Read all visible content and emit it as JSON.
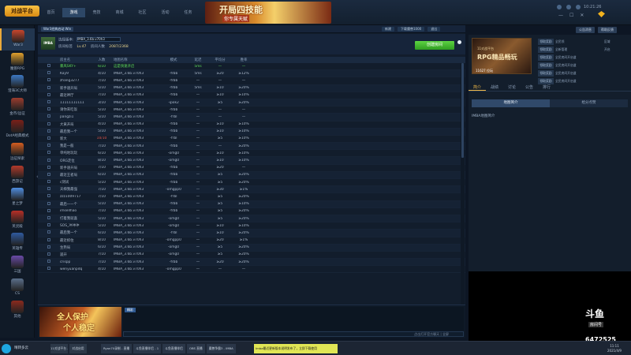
{
  "topbar": {
    "logo": "对战平台",
    "nav": [
      "首页",
      "游戏",
      "竞技",
      "商城",
      "社区",
      "活动",
      "任务",
      "客服"
    ],
    "active_nav_index": 1,
    "banner_title": "开局四技能",
    "banner_subtitle": "你专属天赋",
    "time": "10:21:26",
    "window_controls": [
      "—",
      "☐",
      "✕"
    ]
  },
  "sidebar": {
    "items": [
      {
        "label": "War3",
        "color": "#c8452c"
      },
      {
        "label": "魔兽RPG",
        "color": "#e2a12c"
      },
      {
        "label": "澄海3C大师",
        "color": "#3c78c2"
      },
      {
        "label": "金币/远征",
        "color": "#9b3c2e"
      },
      {
        "label": "DotA经典模式",
        "color": "#7a1f18"
      },
      {
        "label": "远征探索",
        "color": "#d45d1f"
      },
      {
        "label": "西游记",
        "color": "#b33a2b"
      },
      {
        "label": "星之梦",
        "color": "#4f8de0"
      },
      {
        "label": "英灵殿",
        "color": "#b82f27"
      },
      {
        "label": "英雄传",
        "color": "#2f5a9f"
      },
      {
        "label": "三国",
        "color": "#6a4aa8"
      },
      {
        "label": "CS",
        "color": "#5a6f8a"
      },
      {
        "label": "其他",
        "color": "#8b2a1e"
      }
    ],
    "selected_index": 0
  },
  "room": {
    "tag": "War3经典启动 Win",
    "right_buttons": [
      "新建",
      "下载魔兽1000",
      "退出"
    ],
    "map_thumb": "IMBA",
    "version_label": "选择版本:",
    "version_value": "IMBA_3.6b.v70h3",
    "info_label": "房间标签",
    "info_items": [
      "Lv.47",
      "房间人数",
      "2087/2368"
    ],
    "create_button": "创建房间"
  },
  "table": {
    "headers": [
      "",
      "房主名",
      "人数",
      "地图名称",
      "模式",
      "延迟",
      "平均分",
      "胜率"
    ],
    "rows": [
      {
        "name": "暴风SKY+",
        "players": "6/10",
        "map": "这是快速开启",
        "mode": "",
        "ping": "5ms",
        "score": "—",
        "rate": "—",
        "highlight": true,
        "full": false
      },
      {
        "name": "Kay9",
        "players": "4/10",
        "map": "IMBA_3.6b.v70h3",
        "mode": "-frbb",
        "ping": "5ms",
        "score": "≥20",
        "rate": "≥12%",
        "highlight": false,
        "full": false
      },
      {
        "name": "zhang3277",
        "players": "7/10",
        "map": "IMBA_3.6b.v70h3",
        "mode": "-frbb",
        "ping": "—",
        "score": "—",
        "rate": "—",
        "highlight": false,
        "full": false
      },
      {
        "name": "新手速开局",
        "players": "5/10",
        "map": "IMBA_3.6b.v70h3",
        "mode": "-frbb",
        "ping": "5ms",
        "score": "≥10",
        "rate": "≥20%",
        "highlight": false,
        "full": false
      },
      {
        "name": "最近神厅",
        "players": "7/10",
        "map": "IMBA_3.6b.v70h3",
        "mode": "-frbb",
        "ping": "—",
        "score": "≥10",
        "rate": "≥10%",
        "highlight": false,
        "full": false
      },
      {
        "name": "11111111111",
        "players": "3/10",
        "map": "IMBA_3.6b.v70h3",
        "mode": "-ipok2",
        "ping": "—",
        "score": "≥5",
        "rate": "≥20%",
        "highlight": false,
        "full": false
      },
      {
        "name": "请你来吃饭",
        "players": "5/10",
        "map": "IMBA_3.6b.v70h3",
        "mode": "-frbb",
        "ping": "—",
        "score": "—",
        "rate": "—",
        "highlight": false,
        "full": false
      },
      {
        "name": "pangzi1",
        "players": "5/10",
        "map": "IMBA_3.6b.v70h3",
        "mode": "-frbl",
        "ping": "—",
        "score": "—",
        "rate": "—",
        "highlight": false,
        "full": false
      },
      {
        "name": "大黄开局",
        "players": "4/10",
        "map": "IMBA_3.6b.v70h3",
        "mode": "-frbb",
        "ping": "—",
        "score": "≥10",
        "rate": "≥10%",
        "highlight": false,
        "full": false
      },
      {
        "name": "最后我一个",
        "players": "5/10",
        "map": "IMBA_3.6b.v70h3",
        "mode": "-frbb",
        "ping": "—",
        "score": "≥10",
        "rate": "≥10%",
        "highlight": false,
        "full": false
      },
      {
        "name": "新大",
        "players": "10/10",
        "map": "IMBA_3.6b.v70h3",
        "mode": "-frbl",
        "ping": "—",
        "score": "≥5",
        "rate": "≥10%",
        "highlight": false,
        "full": true
      },
      {
        "name": "我是一般",
        "players": "7/10",
        "map": "IMBA_3.6b.v70h3",
        "mode": "-frbb",
        "ping": "—",
        "score": "—",
        "rate": "≥20%",
        "highlight": false,
        "full": false
      },
      {
        "name": "单纯地玩玩",
        "players": "6/10",
        "map": "IMBA_3.6b.v70h3",
        "mode": "-omg0",
        "ping": "—",
        "score": "≥10",
        "rate": "≥10%",
        "highlight": false,
        "full": false
      },
      {
        "name": "ORG走位",
        "players": "8/10",
        "map": "IMBA_3.6b.v70h3",
        "mode": "-omg0",
        "ping": "—",
        "score": "≥10",
        "rate": "≥10%",
        "highlight": false,
        "full": false
      },
      {
        "name": "新手速开局",
        "players": "7/10",
        "map": "IMBA_3.6b.v70h3",
        "mode": "-frbb",
        "ping": "—",
        "score": "≥20",
        "rate": "—",
        "highlight": false,
        "full": false
      },
      {
        "name": "最近王者局",
        "players": "6/10",
        "map": "IMBA_3.6b.v70h3",
        "mode": "-frbb",
        "ping": "—",
        "score": "≥5",
        "rate": "≥20%",
        "highlight": false,
        "full": false
      },
      {
        "name": "c测试",
        "players": "5/10",
        "map": "IMBA_3.6b.v70h3",
        "mode": "-frbb",
        "ping": "—",
        "score": "≥5",
        "rate": "≥20%",
        "highlight": false,
        "full": false
      },
      {
        "name": "天梯我最强",
        "players": "7/10",
        "map": "IMBA_3.6b.v70h3",
        "mode": "-omgpp0",
        "ping": "—",
        "score": "≥30",
        "rate": "≥1%",
        "highlight": false,
        "full": false
      },
      {
        "name": "zzz1009717",
        "players": "7/10",
        "map": "IMBA_3.6b.v70h3",
        "mode": "-frbl",
        "ping": "—",
        "score": "≥5",
        "rate": "≥20%",
        "highlight": false,
        "full": false
      },
      {
        "name": "最后一一个",
        "players": "5/10",
        "map": "IMBA_3.6b.v70h3",
        "mode": "-frbb",
        "ping": "—",
        "score": "≥5",
        "rate": "≥10%",
        "highlight": false,
        "full": false
      },
      {
        "name": "imsellhao",
        "players": "7/10",
        "map": "IMBA_3.6b.v70h3",
        "mode": "-frbb",
        "ping": "—",
        "score": "≥5",
        "rate": "≥20%",
        "highlight": false,
        "full": false
      },
      {
        "name": "打着我就喜",
        "players": "5/10",
        "map": "IMBA_3.6b.v70h3",
        "mode": "-omg0",
        "ping": "—",
        "score": "≥5",
        "rate": "≥20%",
        "highlight": false,
        "full": false
      },
      {
        "name": "SOS_冲冲冲",
        "players": "5/10",
        "map": "IMBA_3.6b.v70h3",
        "mode": "-omg0",
        "ping": "—",
        "score": "≥10",
        "rate": "≥10%",
        "highlight": false,
        "full": false
      },
      {
        "name": "最后我一个",
        "players": "6/10",
        "map": "IMBA_3.6b.v70h3",
        "mode": "-frbl",
        "ping": "—",
        "score": "≥10",
        "rate": "≥20%",
        "highlight": false,
        "full": false
      },
      {
        "name": "最近抓住",
        "players": "8/10",
        "map": "IMBA_3.6b.v70h3",
        "mode": "-omgpp0",
        "ping": "—",
        "score": "≥20",
        "rate": "≥1%",
        "highlight": false,
        "full": false
      },
      {
        "name": "生熟局",
        "players": "6/10",
        "map": "IMBA_3.6b.v70h3",
        "mode": "-omg0",
        "ping": "—",
        "score": "≥5",
        "rate": "≥20%",
        "highlight": false,
        "full": false
      },
      {
        "name": "遥开",
        "players": "7/10",
        "map": "IMBA_3.6b.v70h3",
        "mode": "-omg0",
        "ping": "—",
        "score": "≥5",
        "rate": "≥20%",
        "highlight": false,
        "full": false
      },
      {
        "name": "crispp",
        "players": "7/10",
        "map": "IMBA_3.6b.v70h3",
        "mode": "-frbb",
        "ping": "—",
        "score": "≥20",
        "rate": "≥20%",
        "highlight": false,
        "full": false
      },
      {
        "name": "wenyuanpdq",
        "players": "4/10",
        "map": "IMBA_3.6b.v70h3",
        "mode": "-omgpp0",
        "ping": "—",
        "score": "—",
        "rate": "—",
        "highlight": false,
        "full": false
      }
    ]
  },
  "bottom": {
    "ad_line1": "全人保护",
    "ad_line2": "个人稳定",
    "chat_tag": "精彩",
    "chat_hint": "点击打开官方聊天 | 全屏"
  },
  "right_panel": {
    "top_buttons": [
      "公告消息",
      "帮助反馈"
    ],
    "banner_l1": "11对战平台",
    "banner_l2": "RPG精品畅玩",
    "banner_l3": "11627 位玩",
    "menu": [
      {
        "k": "领取奖励",
        "v": "全民领",
        "x": "区域"
      },
      {
        "k": "领取奖励",
        "v": "全新管理",
        "x": "开启"
      },
      {
        "k": "领取奖励",
        "v": "全民房间开启道",
        "x": ""
      },
      {
        "k": "领取奖励",
        "v": "全民房间开启道",
        "x": ""
      },
      {
        "k": "领取奖励",
        "v": "全民房间开启道",
        "x": ""
      },
      {
        "k": "领取奖励",
        "v": "全民房间开启道",
        "x": ""
      }
    ],
    "tabs": [
      "简介",
      "战绩",
      "讨论",
      "公告",
      "排行"
    ],
    "active_tab": 0,
    "subtabs": [
      "地图简介",
      "给分点赞"
    ],
    "active_sub": 0,
    "note": "IMBA地图简介"
  },
  "stream": {
    "logo": "斗鱼",
    "room_label": "房间号",
    "room_number": "6472525"
  },
  "taskbar": {
    "weather": "晴转多云",
    "apps": [
      "11对战平台 - IMBA",
      "对战启用"
    ],
    "tasks": [
      "Ryan70录制 - 直播",
      "斗鱼直播伴侣 - 1",
      "斗鱼直播伴侣",
      "OBS 直播",
      "魔兽争霸3 - IMBA"
    ],
    "notify": "Imba最近更新版本说明发布了，立即下载使用",
    "clock_time": "11:11",
    "clock_date": "2021/4/9"
  }
}
